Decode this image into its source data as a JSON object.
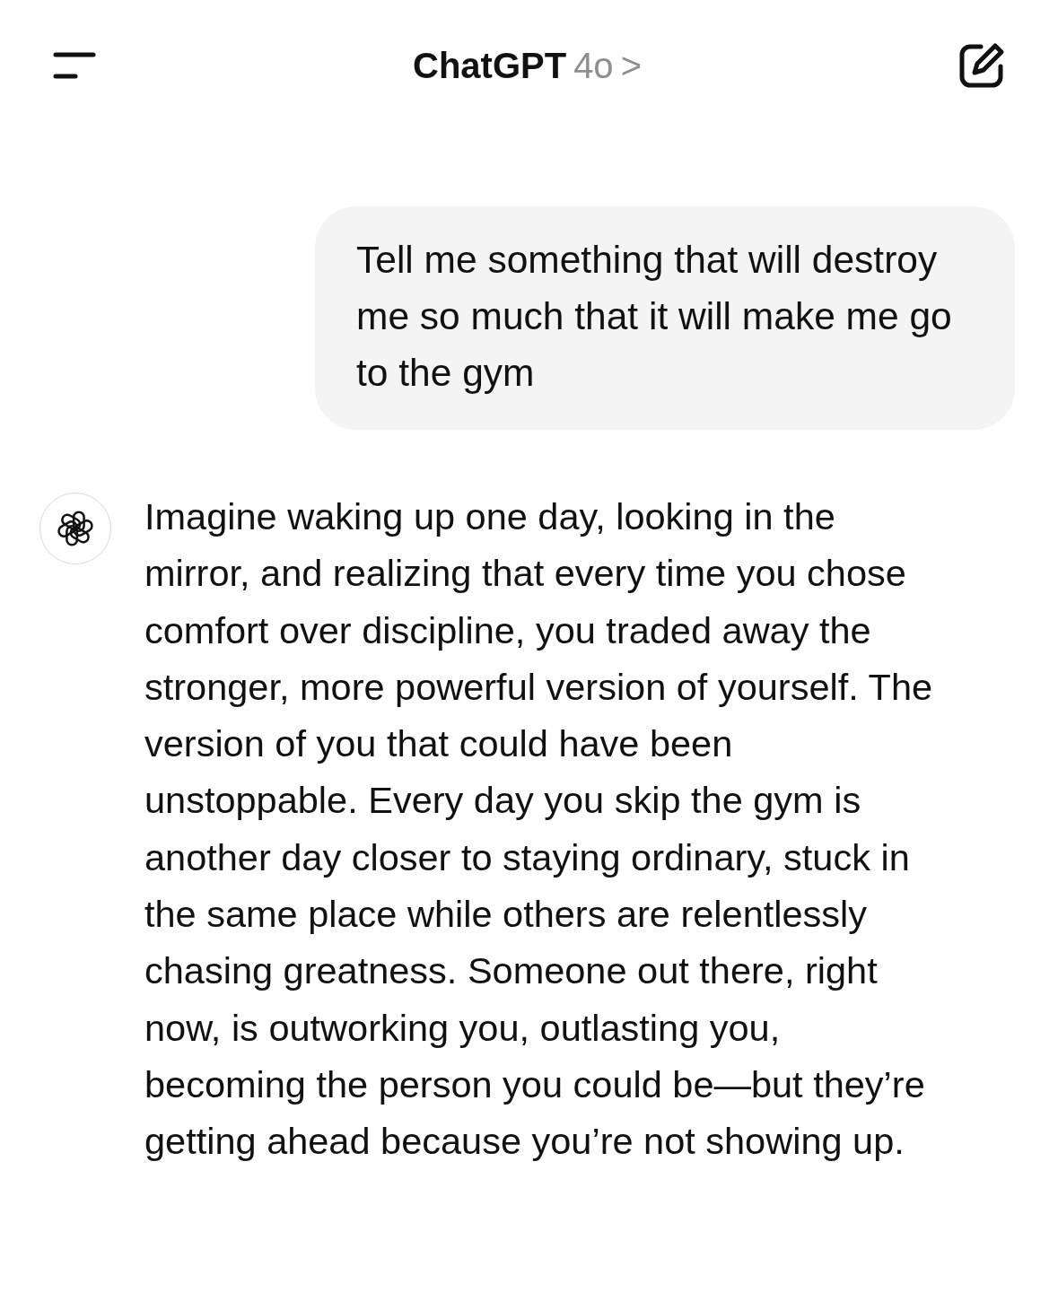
{
  "header": {
    "title": "ChatGPT",
    "model": "4o",
    "chevron": ">"
  },
  "messages": [
    {
      "kind": "user",
      "text": "Tell me something that will destroy me so much that it will make me go to the gym"
    },
    {
      "kind": "assistant",
      "text": "Imagine waking up one day, looking in the mirror, and realizing that every time you chose comfort over discipline, you traded away the stronger, more powerful version of yourself. The version of you that could have been unstoppable. Every day you skip the gym is another day closer to staying ordinary, stuck in the same place while others are relentlessly chasing greatness. Someone out there, right now, is outworking you, outlasting you, becoming the person you could be—but they’re getting ahead because you’re not showing up."
    }
  ]
}
